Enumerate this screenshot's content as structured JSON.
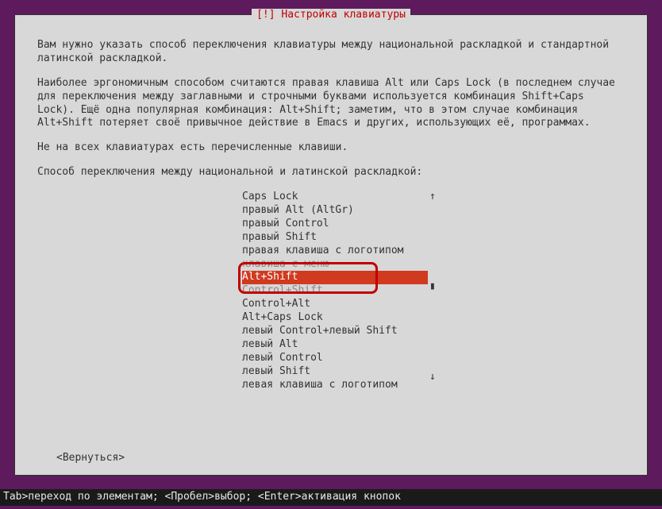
{
  "dialog": {
    "title": "[!] Настройка клавиатуры",
    "paragraphs": {
      "p1": "Вам нужно указать способ переключения клавиатуры между национальной раскладкой и стандартной латинской раскладкой.",
      "p2": "Наиболее эргономичным способом считаются правая клавиша Alt или Caps Lock (в последнем случае для переключения между заглавными и строчными буквами используется комбинация Shift+Caps Lock). Ещё одна популярная комбинация: Alt+Shift; заметим, что в этом случае комбинация Alt+Shift потеряет своё привычное действие в Emacs и других, использующих её, программах.",
      "p3": "Не на всех клавиатурах есть перечисленные клавиши.",
      "prompt": "Способ переключения между национальной и латинской раскладкой:"
    },
    "options": [
      {
        "label": "Caps Lock",
        "selected": false,
        "dim": false
      },
      {
        "label": "правый Alt (AltGr)",
        "selected": false,
        "dim": false
      },
      {
        "label": "правый Control",
        "selected": false,
        "dim": false
      },
      {
        "label": "правый Shift",
        "selected": false,
        "dim": false
      },
      {
        "label": "правая клавиша с логотипом",
        "selected": false,
        "dim": false
      },
      {
        "label": "клавиша с меню",
        "selected": false,
        "dim": true
      },
      {
        "label": "Alt+Shift",
        "selected": true,
        "dim": false
      },
      {
        "label": "Control+Shift",
        "selected": false,
        "dim": true
      },
      {
        "label": "Control+Alt",
        "selected": false,
        "dim": false
      },
      {
        "label": "Alt+Caps Lock",
        "selected": false,
        "dim": false
      },
      {
        "label": "левый Control+левый Shift",
        "selected": false,
        "dim": false
      },
      {
        "label": "левый Alt",
        "selected": false,
        "dim": false
      },
      {
        "label": "левый Control",
        "selected": false,
        "dim": false
      },
      {
        "label": "левый Shift",
        "selected": false,
        "dim": false
      },
      {
        "label": "левая клавиша с логотипом",
        "selected": false,
        "dim": false
      }
    ],
    "back_label": "<Вернуться>",
    "scroll": {
      "up": "↑",
      "tick": "▮",
      "down": "↓"
    }
  },
  "status_bar": "Tab>переход по элементам; <Пробел>выбор; <Enter>активация кнопок"
}
